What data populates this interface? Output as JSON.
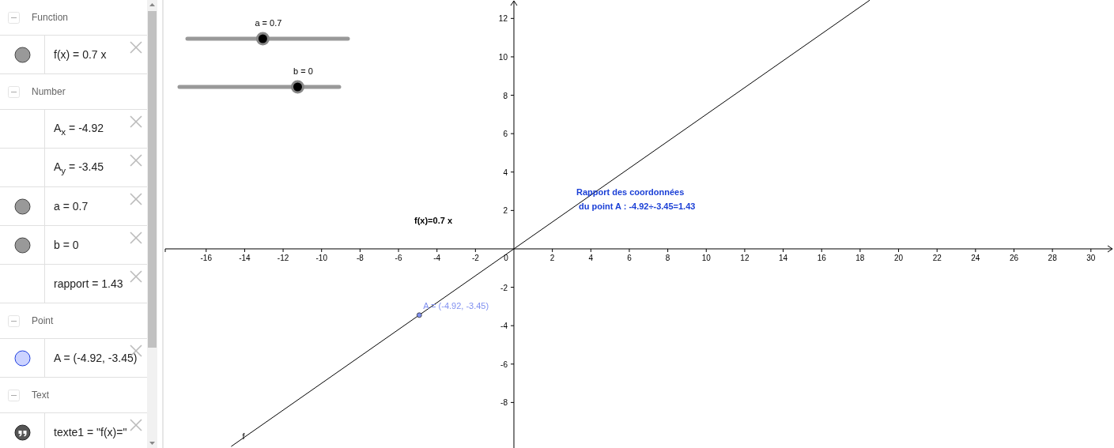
{
  "algebra": {
    "groups": [
      {
        "title": "Function",
        "items": [
          {
            "kind": "dot",
            "color": "#999999",
            "text": "f(x) = 0.7 x"
          }
        ]
      },
      {
        "title": "Number",
        "items": [
          {
            "kind": "none",
            "text": "A$_{x}$ = -4.92"
          },
          {
            "kind": "none",
            "text": "A$_{y}$ = -3.45"
          },
          {
            "kind": "dot",
            "color": "#999999",
            "text": "a = 0.7"
          },
          {
            "kind": "dot",
            "color": "#999999",
            "text": "b = 0"
          },
          {
            "kind": "none",
            "text": "rapport = 1.43"
          }
        ]
      },
      {
        "title": "Point",
        "items": [
          {
            "kind": "dot",
            "color": "#ccd3ff",
            "text": "A = (-4.92, -3.45)"
          }
        ]
      },
      {
        "title": "Text",
        "items": [
          {
            "kind": "quote",
            "text": "texte1 = \"f(x)=\""
          }
        ]
      }
    ]
  },
  "graphics": {
    "sliders": [
      {
        "label": "a = 0.7",
        "level": 0.47
      },
      {
        "label": "b = 0",
        "level": 0.74
      }
    ],
    "chart_data": {
      "type": "line",
      "xlim": [
        -18.21,
        31.2
      ],
      "ylim": [
        -10.37,
        12.96
      ],
      "xticks": [
        -16,
        -14,
        -12,
        -10,
        -8,
        -6,
        -4,
        -2,
        2,
        4,
        6,
        8,
        10,
        12,
        14,
        16,
        18,
        20,
        22,
        24,
        26,
        28,
        30
      ],
      "yticks": [
        -8,
        -6,
        -4,
        -2,
        2,
        4,
        6,
        8,
        10,
        12
      ],
      "x": [
        -14.7,
        18.5
      ],
      "series": [
        {
          "name": "f",
          "color": "#000000",
          "values": [
            -10.29,
            12.95
          ]
        }
      ],
      "annotations": [
        {
          "text": "A = (-4.92, -3.45)",
          "x": -4.92,
          "y": -3.45
        }
      ]
    },
    "origin_label": "0",
    "texts": [
      {
        "lines": [
          "f(x)=0.7 x"
        ],
        "color": "#000000"
      },
      {
        "lines": [
          "Rapport des coordonnées",
          " du point A : -4.92÷-3.45=1.43"
        ],
        "color": "#1a3fd6"
      }
    ]
  }
}
